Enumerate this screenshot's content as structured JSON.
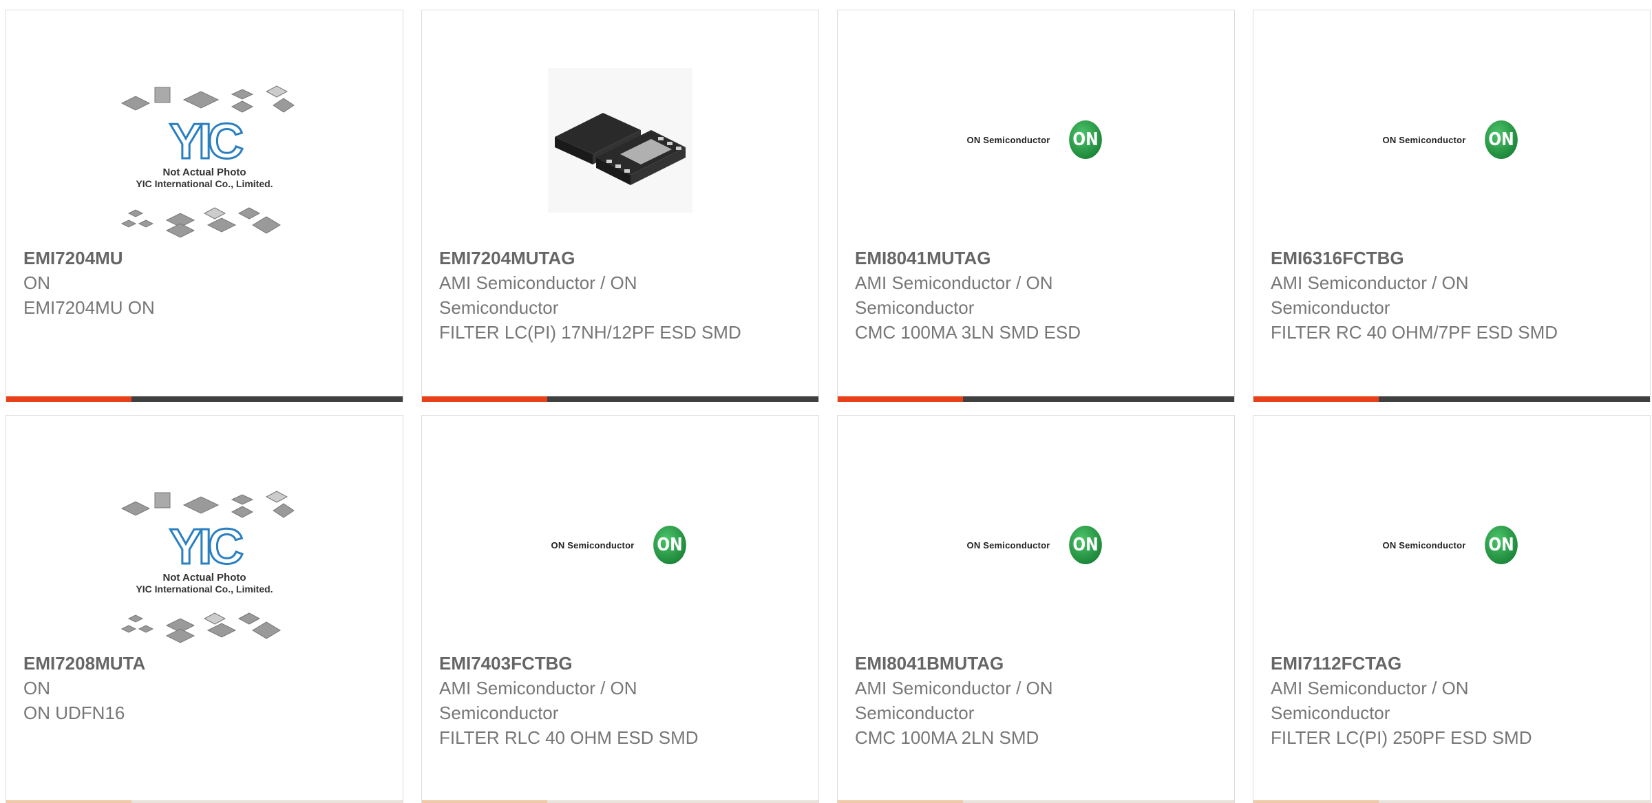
{
  "colors": {
    "accent": "#e8411a",
    "bar": "#404040",
    "text": "#777777",
    "on_green": "#1f8a3c",
    "yic_blue": "#2a7fc1"
  },
  "yic_image": {
    "line1": "Not Actual Photo",
    "line2": "YIC International Co., Limited."
  },
  "on_logo": {
    "text": "ON Semiconductor",
    "badge": "ON"
  },
  "products": [
    {
      "part": "EMI7204MU",
      "maker": "ON",
      "desc": "EMI7204MU ON",
      "image": "yic-placeholder"
    },
    {
      "part": "EMI7204MUTAG",
      "maker": "AMI Semiconductor / ON Semiconductor",
      "desc": "FILTER LC(PI) 17NH/12PF ESD SMD",
      "image": "chip-photo"
    },
    {
      "part": "EMI8041MUTAG",
      "maker": "AMI Semiconductor / ON Semiconductor",
      "desc": "CMC 100MA 3LN SMD ESD",
      "image": "on-logo"
    },
    {
      "part": "EMI6316FCTBG",
      "maker": "AMI Semiconductor / ON Semiconductor",
      "desc": "FILTER RC 40 OHM/7PF ESD SMD",
      "image": "on-logo"
    },
    {
      "part": "EMI7208MUTA",
      "maker": "ON",
      "desc": "ON UDFN16",
      "image": "yic-placeholder"
    },
    {
      "part": "EMI7403FCTBG",
      "maker": "AMI Semiconductor / ON Semiconductor",
      "desc": "FILTER RLC 40 OHM ESD SMD",
      "image": "on-logo"
    },
    {
      "part": "EMI8041BMUTAG",
      "maker": "AMI Semiconductor / ON Semiconductor",
      "desc": "CMC 100MA 2LN SMD",
      "image": "on-logo"
    },
    {
      "part": "EMI7112FCTAG",
      "maker": "AMI Semiconductor / ON Semiconductor",
      "desc": "FILTER LC(PI) 250PF ESD SMD",
      "image": "on-logo"
    }
  ]
}
